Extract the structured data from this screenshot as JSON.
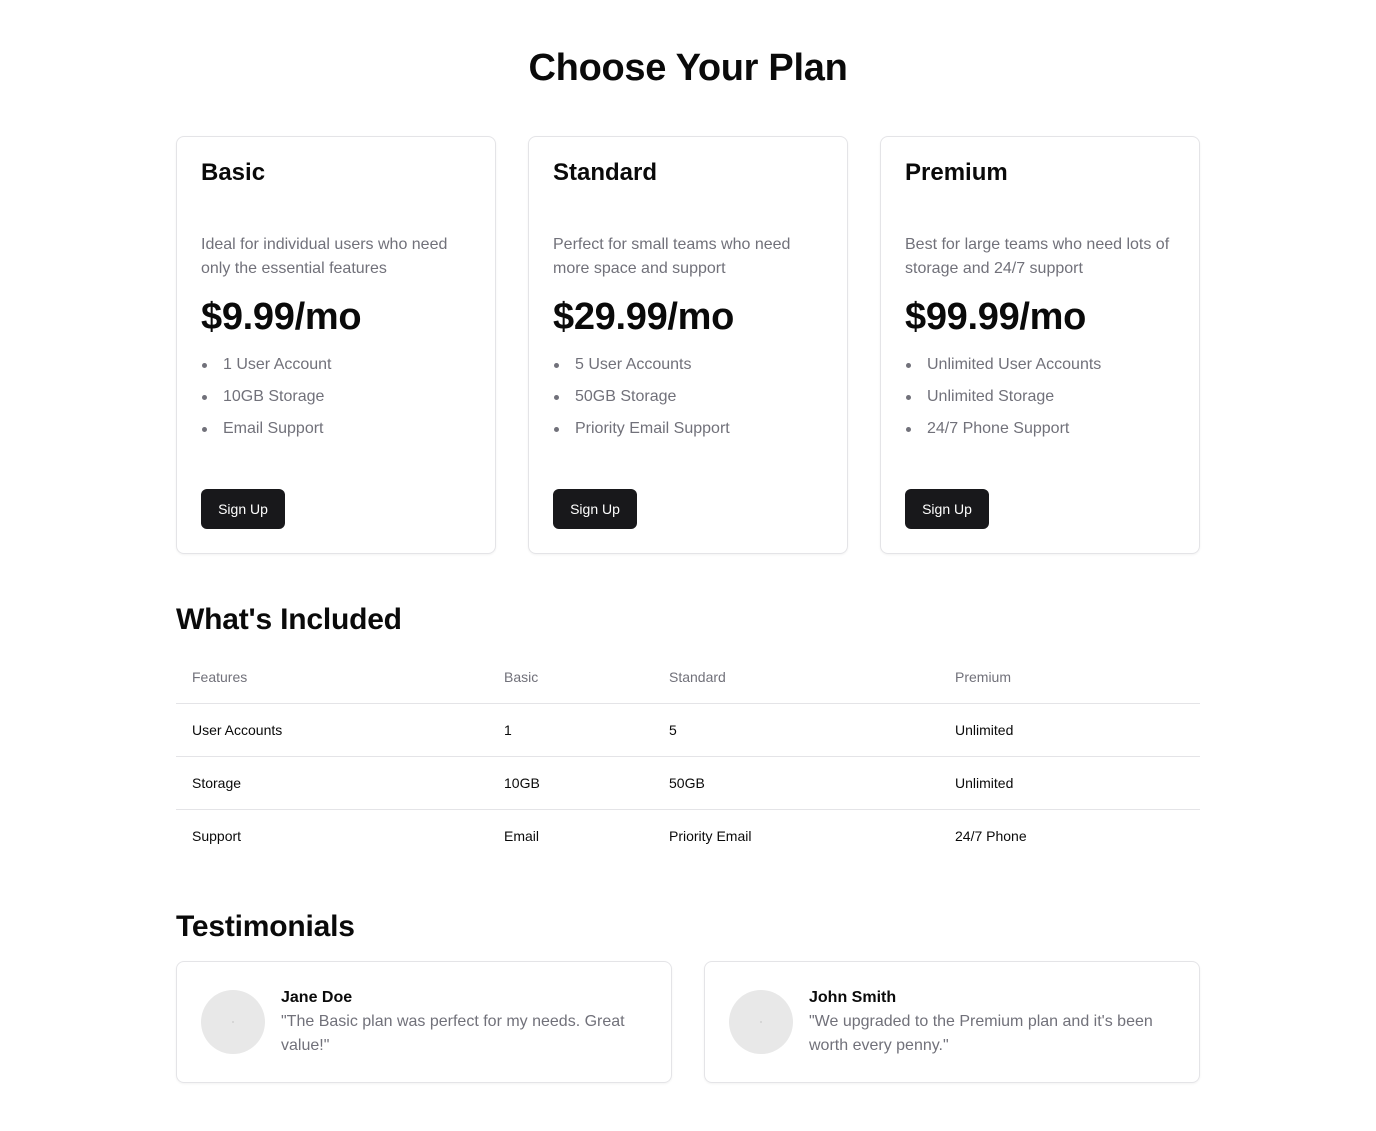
{
  "page": {
    "title": "Choose Your Plan"
  },
  "plans": [
    {
      "name": "Basic",
      "description": "Ideal for individual users who need only the essential features",
      "price": "$9.99/mo",
      "features": [
        "1 User Account",
        "10GB Storage",
        "Email Support"
      ],
      "cta_label": "Sign Up"
    },
    {
      "name": "Standard",
      "description": "Perfect for small teams who need more space and support",
      "price": "$29.99/mo",
      "features": [
        "5 User Accounts",
        "50GB Storage",
        "Priority Email Support"
      ],
      "cta_label": "Sign Up"
    },
    {
      "name": "Premium",
      "description": "Best for large teams who need lots of storage and 24/7 support",
      "price": "$99.99/mo",
      "features": [
        "Unlimited User Accounts",
        "Unlimited Storage",
        "24/7 Phone Support"
      ],
      "cta_label": "Sign Up"
    }
  ],
  "included": {
    "title": "What's Included",
    "headers": [
      "Features",
      "Basic",
      "Standard",
      "Premium"
    ],
    "rows": [
      [
        "User Accounts",
        "1",
        "5",
        "Unlimited"
      ],
      [
        "Storage",
        "10GB",
        "50GB",
        "Unlimited"
      ],
      [
        "Support",
        "Email",
        "Priority Email",
        "24/7 Phone"
      ]
    ]
  },
  "testimonials": {
    "title": "Testimonials",
    "items": [
      {
        "name": "Jane Doe",
        "quote": "\"The Basic plan was perfect for my needs. Great value!\""
      },
      {
        "name": "John Smith",
        "quote": "\"We upgraded to the Premium plan and it's been worth every penny.\""
      }
    ]
  },
  "colors": {
    "text_primary": "#0a0a0a",
    "text_muted": "#71717a",
    "border": "#e4e4e7",
    "button_bg": "#18181b",
    "button_text": "#ffffff",
    "avatar_bg": "#e8e8e8"
  }
}
